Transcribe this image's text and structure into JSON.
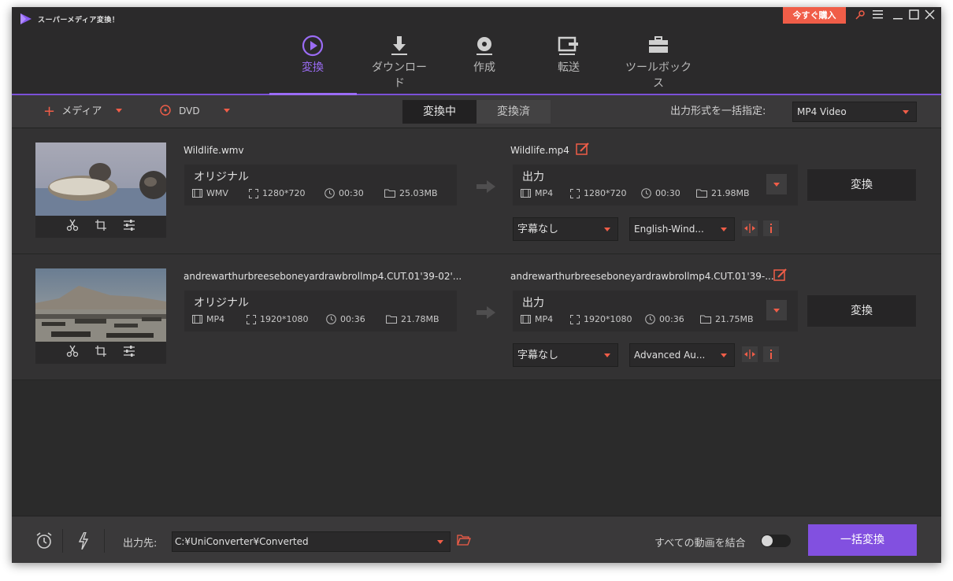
{
  "app": {
    "title": "スーパーメディア変換！",
    "buy_label": "今すぐ購入"
  },
  "nav": {
    "tabs": [
      {
        "label": "変換",
        "icon": "convert-icon"
      },
      {
        "label": "ダウンロード",
        "icon": "download-icon"
      },
      {
        "label": "作成",
        "icon": "disc-icon"
      },
      {
        "label": "転送",
        "icon": "transfer-icon"
      },
      {
        "label": "ツールボックス",
        "icon": "toolbox-icon"
      }
    ]
  },
  "toolbar": {
    "media_label": "メディア",
    "dvd_label": "DVD",
    "tab_converting": "変換中",
    "tab_converted": "変換済",
    "output_format_label": "出力形式を一括指定:",
    "output_format_value": "MP4 Video"
  },
  "files": [
    {
      "source_name": "Wildlife.wmv",
      "original_label": "オリジナル",
      "src_format": "WMV",
      "src_res": "1280*720",
      "src_dur": "00:30",
      "src_size": "25.03MB",
      "target_name": "Wildlife.mp4",
      "output_label": "出力",
      "dst_format": "MP4",
      "dst_res": "1280*720",
      "dst_dur": "00:30",
      "dst_size": "21.98MB",
      "subtitle": "字幕なし",
      "audio": "English-Wind...",
      "convert_label": "変換"
    },
    {
      "source_name": "andrewarthurbreeseboneyardrawbrollmp4.CUT.01'39-02'...",
      "original_label": "オリジナル",
      "src_format": "MP4",
      "src_res": "1920*1080",
      "src_dur": "00:36",
      "src_size": "21.78MB",
      "target_name": "andrewarthurbreeseboneyardrawbrollmp4.CUT.01'39-...",
      "output_label": "出力",
      "dst_format": "MP4",
      "dst_res": "1920*1080",
      "dst_dur": "00:36",
      "dst_size": "21.75MB",
      "subtitle": "字幕なし",
      "audio": "Advanced Au...",
      "convert_label": "変換"
    }
  ],
  "bottom": {
    "output_dest_label": "出力先:",
    "output_path": "C:¥UniConverter¥Converted",
    "merge_label": "すべての動画を結合",
    "merge_enabled": false,
    "convert_all_label": "一括変換"
  },
  "colors": {
    "accent": "#9b6cf5",
    "brand_red": "#f05d48",
    "primary_button": "#8250e0"
  }
}
